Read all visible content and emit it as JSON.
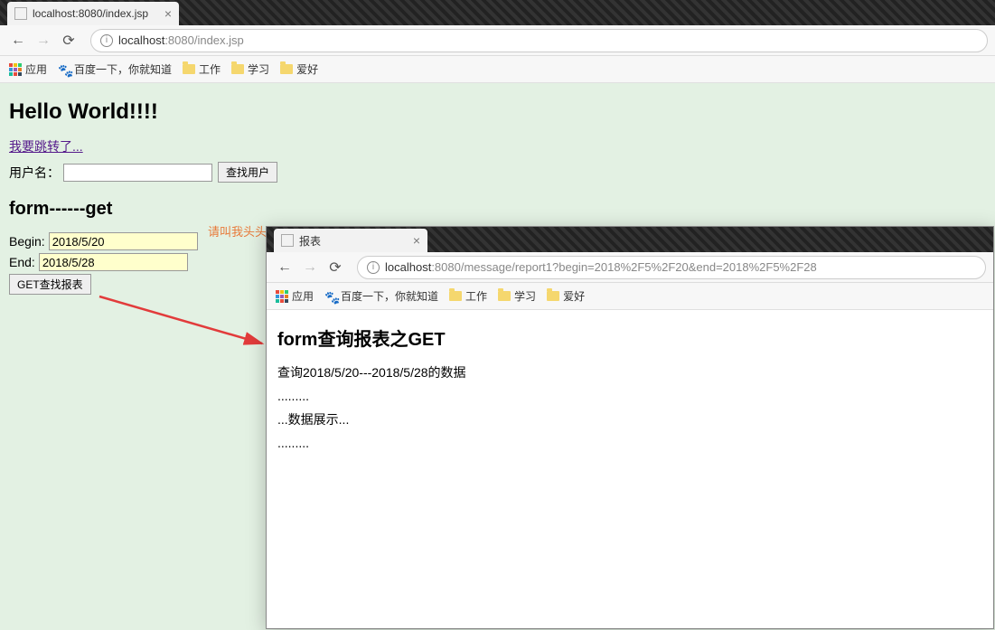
{
  "window1": {
    "tab_title": "localhost:8080/index.jsp",
    "url_host": "localhost",
    "url_port_path": ":8080/index.jsp",
    "bookmarks": {
      "apps": "应用",
      "baidu": "百度一下，你就知道",
      "items": [
        "工作",
        "学习",
        "爱好"
      ]
    },
    "page": {
      "heading": "Hello World!!!!",
      "link": "我要跳转了...",
      "username_label": "用户名：",
      "search_user_btn": "查找用户",
      "formget_heading": "form------get",
      "begin_label": "Begin:",
      "begin_value": "2018/5/20",
      "end_label": "End:",
      "end_value": "2018/5/28",
      "get_report_btn": "GET查找报表"
    }
  },
  "watermark": "请叫我头头哥",
  "window2": {
    "tab_title": "报表",
    "url_host": "localhost",
    "url_port_path": ":8080/message/report1",
    "url_query": "?begin=2018%2F5%2F20&end=2018%2F5%2F28",
    "bookmarks": {
      "apps": "应用",
      "baidu": "百度一下，你就知道",
      "items": [
        "工作",
        "学习",
        "爱好"
      ]
    },
    "page": {
      "heading": "form查询报表之GET",
      "line1": "查询2018/5/20---2018/5/28的数据",
      "line2": ".........",
      "line3": "...数据展示...",
      "line4": "........."
    }
  }
}
